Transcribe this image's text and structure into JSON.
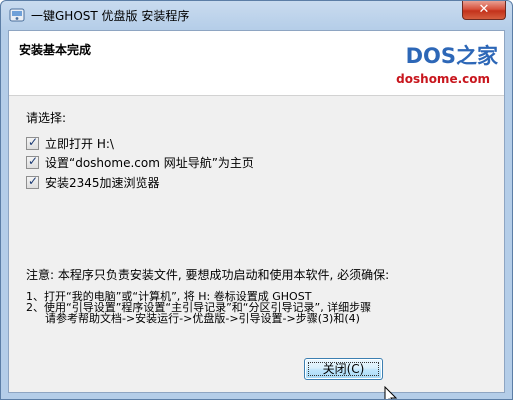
{
  "window": {
    "title": "一键GHOST 优盘版 安装程序",
    "close_glyph": "✕"
  },
  "header": {
    "title": "安装基本完成",
    "logo_text": "DOS之家",
    "logo_url_text": "doshome.com"
  },
  "body": {
    "prompt": "请选择:",
    "options": [
      {
        "label": "立即打开 H:\\",
        "checked": true
      },
      {
        "label": "设置“doshome.com 网址导航”为主页",
        "checked": true
      },
      {
        "label": "安装2345加速浏览器",
        "checked": true
      }
    ],
    "notice": "注意: 本程序只负责安装文件, 要想成功启动和使用本软件, 必须确保:",
    "steps": [
      "1、打开“我的电脑”或“计算机”, 将 H: 卷标设置成 GHOST",
      "2、使用“引导设置”程序设置“主引导记录”和“分区引导记录”, 详细步骤",
      "请参考帮助文档->安装运行->优盘版->引导设置->步骤(3)和(4)"
    ]
  },
  "footer": {
    "close_button": "关闭(C)"
  },
  "colors": {
    "logo_blue": "#2d67b7",
    "logo_red": "#c8161d"
  }
}
